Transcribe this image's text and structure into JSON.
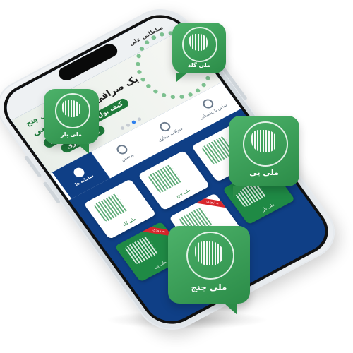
{
  "app": {
    "user_label": "سلطانی علی",
    "banner": {
      "brand": "ملی چنج",
      "title_prefix": "یک صرافی",
      "title_highlight": "دوست داشتنی",
      "pill_1": "کیف پول اختصاصی رایگان",
      "pill_2": "واریز فوری"
    },
    "carousel_pages": 4,
    "carousel_active": 2,
    "tabs": [
      {
        "label": "سامانه ها",
        "active": true,
        "icon": "grid-icon"
      },
      {
        "label": "پرسش",
        "active": false,
        "icon": "question-icon"
      },
      {
        "label": "سوالات متداول",
        "active": false,
        "icon": "faq-icon"
      },
      {
        "label": "تماس با پشتیبانی",
        "active": false,
        "icon": "phone-icon"
      }
    ],
    "cards": [
      {
        "label": "ملی گلد",
        "style": "white",
        "ribbon": ""
      },
      {
        "label": "ملی چنج",
        "style": "white",
        "ribbon": ""
      },
      {
        "label": "ملی بار",
        "style": "white",
        "ribbon": ""
      },
      {
        "label": "ملی پی",
        "style": "green",
        "ribbon": "به زودی"
      },
      {
        "label": "ملی پی",
        "style": "white",
        "ribbon": "به زودی"
      },
      {
        "label": "ملی بار",
        "style": "green",
        "ribbon": "به زودی"
      }
    ]
  },
  "badges": {
    "top_right": "ملی گلد",
    "left": "ملی بار",
    "right": "ملی پی",
    "bottom": "ملی چنج"
  },
  "colors": {
    "brand_green": "#2b8c48",
    "screen_blue": "#0f3f86",
    "ribbon_red": "#d8262c"
  }
}
